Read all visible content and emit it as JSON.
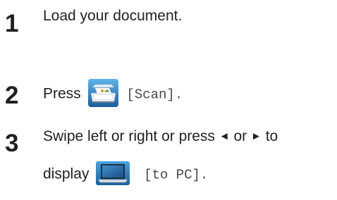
{
  "steps": [
    {
      "number": "1",
      "text": "Load your document."
    },
    {
      "number": "2",
      "prefix": "Press",
      "icon": "scanner-icon",
      "button_label": "[Scan]."
    },
    {
      "number": "3",
      "line1_a": "Swipe left or right or press",
      "left_arrow": "◄",
      "or_word": "or",
      "right_arrow": "►",
      "to_word": "to",
      "line2_prefix": "display",
      "icon": "laptop-icon",
      "button_label": "[to PC]."
    }
  ],
  "colors": {
    "text": "#231f20",
    "icon_bg_dark": "#1c5f9a",
    "icon_bg_light": "#4aa3df"
  }
}
